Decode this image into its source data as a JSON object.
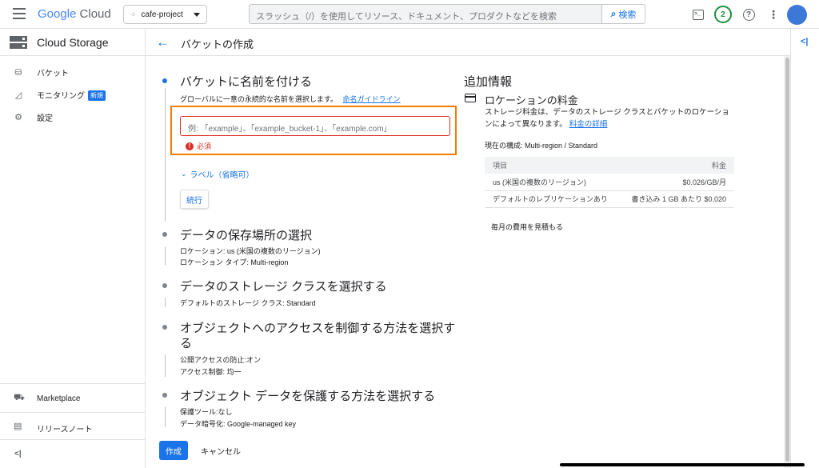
{
  "header": {
    "logo_google": "Google",
    "logo_cloud": "Cloud",
    "project": "cafe-project",
    "search_placeholder": "スラッシュ（/）を使用してリソース、ドキュメント、プロダクトなどを検索",
    "search_button": "検索",
    "notification_count": "2"
  },
  "sidebar": {
    "title": "Cloud Storage",
    "items": [
      {
        "label": "バケット",
        "icon": "bucket-icon"
      },
      {
        "label": "モニタリング",
        "icon": "chart-icon",
        "badge": "新規"
      },
      {
        "label": "設定",
        "icon": "gear-icon"
      }
    ],
    "bottom_items": [
      {
        "label": "Marketplace",
        "icon": "marketplace-icon"
      },
      {
        "label": "リリースノート",
        "icon": "notes-icon"
      }
    ]
  },
  "page": {
    "title": "バケットの作成"
  },
  "steps": {
    "name": {
      "title": "バケットに名前を付ける",
      "desc": "グローバルに一意の永続的な名前を選択します。",
      "link": "命名ガイドライン",
      "placeholder": "例: 「example」、「example_bucket-1」、「example.com」",
      "error": "必須",
      "labels_toggle": "ラベル（省略可）",
      "continue": "続行"
    },
    "location": {
      "title": "データの保存場所の選択",
      "line1": "ロケーション: us (米国の複数のリージョン)",
      "line2": "ロケーション タイプ: Multi-region"
    },
    "storage_class": {
      "title": "データのストレージ クラスを選択する",
      "line1": "デフォルトのストレージ クラス: Standard"
    },
    "access": {
      "title_line1": "オブジェクトへのアクセスを制御する方法を選択す",
      "title_line2": "る",
      "line1": "公開アクセスの防止:オン",
      "line2": "アクセス制御: 均一"
    },
    "protection": {
      "title": "オブジェクト データを保護する方法を選択する",
      "line1": "保護ツール:なし",
      "line2": "データ暗号化: Google-managed key"
    }
  },
  "actions": {
    "create": "作成",
    "cancel": "キャンセル"
  },
  "info": {
    "title": "追加情報",
    "pricing_title": "ロケーションの料金",
    "pricing_desc": "ストレージ料金は、データのストレージ クラスとバケットのロケーションによって異なります。",
    "pricing_link": "料金の詳細",
    "current_config": "現在の構成: Multi-region / Standard",
    "table": {
      "headers": [
        "項目",
        "料金"
      ],
      "rows": [
        [
          "us (米国の複数のリージョン)",
          "$0.026/GB/月"
        ],
        [
          "デフォルトのレプリケーションあり",
          "書き込み 1 GB あたり $0.020"
        ]
      ]
    },
    "estimate": "毎月の費用を見積もる"
  },
  "colors": {
    "accent": "#1a73e8",
    "error": "#d93025",
    "highlight": "#f57c00"
  }
}
